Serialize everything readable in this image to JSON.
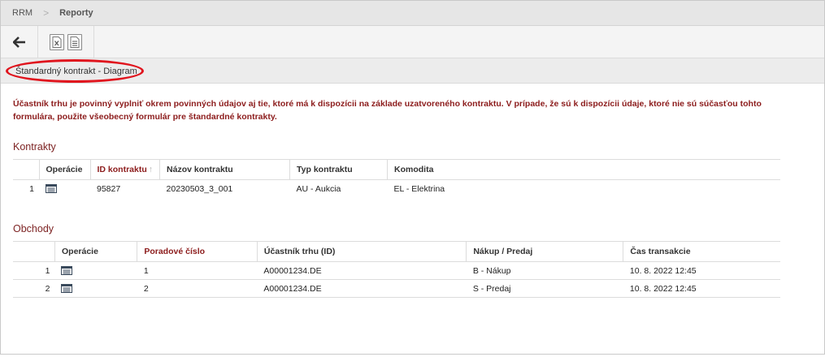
{
  "breadcrumb": {
    "root": "RRM",
    "separator": ">",
    "current": "Reporty"
  },
  "toolbar": {
    "back_icon": "arrow-left-icon",
    "excel_icon": "excel-export-icon",
    "doc_icon": "document-export-icon"
  },
  "tab": {
    "label": "Štandardný kontrakt - Diagram",
    "highlight_color": "#e0141d"
  },
  "notice": "Účastník trhu je povinný vyplniť okrem povinných údajov aj tie, ktoré má k dispozícii na základe uzatvoreného kontraktu. V prípade, že sú k dispozícii údaje, ktoré nie sú súčasťou tohto formulára, použite všeobecný formulár pre štandardné kontrakty.",
  "contracts": {
    "title": "Kontrakty",
    "headers": {
      "ops": "Operácie",
      "id": "ID kontraktu",
      "name": "Názov kontraktu",
      "type": "Typ kontraktu",
      "commodity": "Komodita"
    },
    "sort_arrow": "↑",
    "rows": [
      {
        "num": "1",
        "id": "95827",
        "name": "20230503_3_001",
        "type": "AU - Aukcia",
        "commodity": "EL - Elektrina"
      }
    ]
  },
  "trades": {
    "title": "Obchody",
    "headers": {
      "ops": "Operácie",
      "order": "Poradové číslo",
      "participant": "Účastník trhu (ID)",
      "side": "Nákup / Predaj",
      "time": "Čas transakcie"
    },
    "rows": [
      {
        "num": "1",
        "order": "1",
        "participant": "A00001234.DE",
        "side": "B - Nákup",
        "time": "10. 8. 2022 12:45"
      },
      {
        "num": "2",
        "order": "2",
        "participant": "A00001234.DE",
        "side": "S - Predaj",
        "time": "10. 8. 2022 12:45"
      }
    ]
  },
  "colors": {
    "accent": "#8c1c1c",
    "section_title": "#7d2323"
  }
}
